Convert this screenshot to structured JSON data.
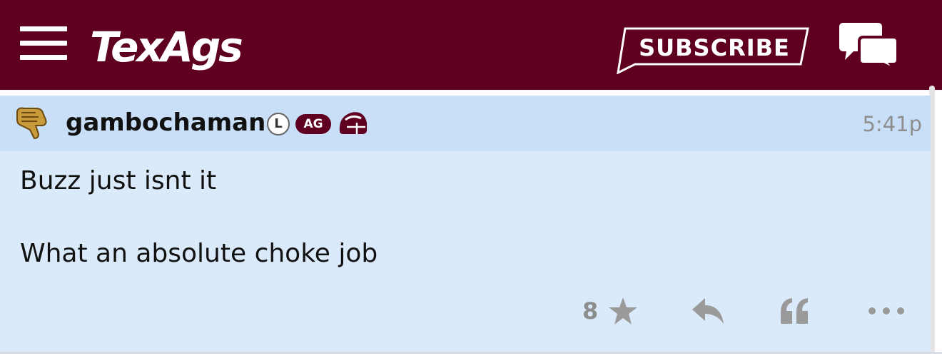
{
  "header": {
    "logo_text": "TexAgs",
    "subscribe_label": "SUBSCRIBE",
    "colors": {
      "bar": "#5f0023",
      "text": "#ffffff"
    },
    "icons": {
      "menu": "hamburger-menu-icon",
      "chat": "chat-bubbles-icon"
    }
  },
  "post": {
    "username": "gambochaman",
    "badges": {
      "l": "L",
      "ag": "AG"
    },
    "timestamp": "5:41p",
    "body": [
      "Buzz just isnt it",
      "What an absolute choke job"
    ],
    "likes": "8",
    "colors": {
      "header_bg": "#c8dff7",
      "body_bg": "#dbeafa",
      "ag_badge": "#5f0023"
    },
    "icons": {
      "avatar": "thumbs-down-avatar-icon",
      "helmet": "helmet-icon",
      "star": "star-icon",
      "reply": "reply-arrow-icon",
      "quote": "quote-icon",
      "more": "more-dots-icon"
    }
  }
}
